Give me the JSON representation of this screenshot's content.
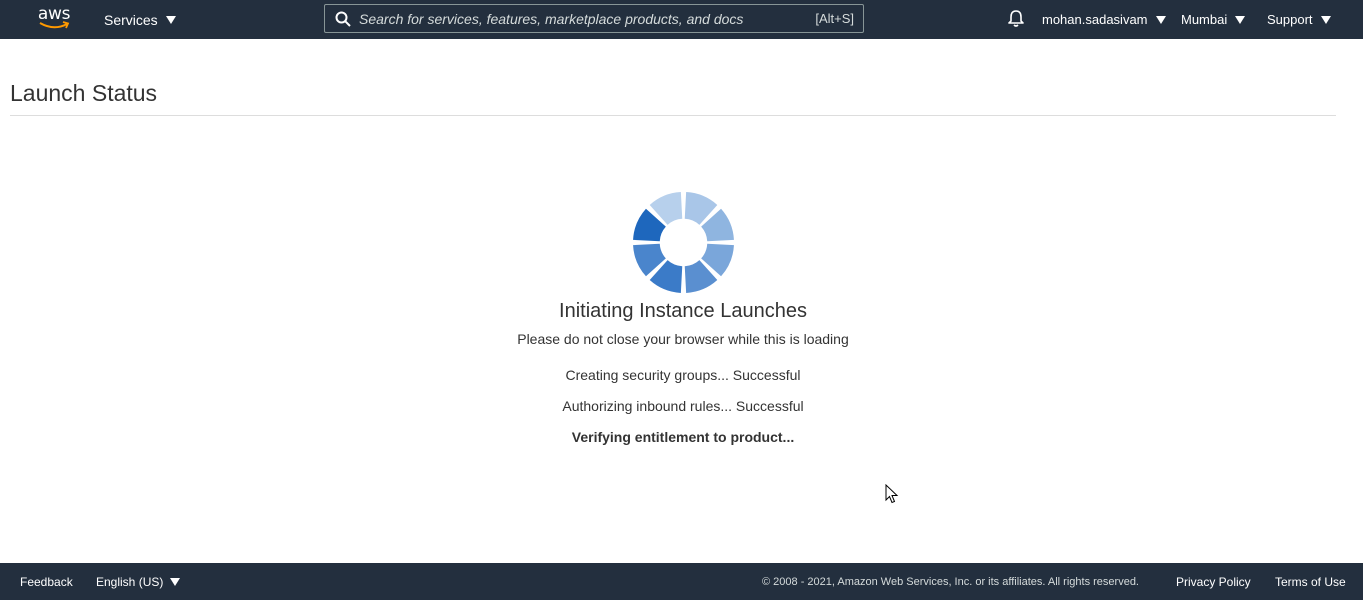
{
  "nav": {
    "logo_text": "aws",
    "services_label": "Services",
    "search": {
      "placeholder": "Search for services, features, marketplace products, and docs",
      "shortcut": "[Alt+S]"
    },
    "user_label": "mohan.sadasivam",
    "region_label": "Mumbai",
    "support_label": "Support"
  },
  "page": {
    "title": "Launch Status"
  },
  "status": {
    "heading": "Initiating Instance Launches",
    "subtext": "Please do not close your browser while this is loading",
    "steps": [
      {
        "text": "Creating security groups... Successful",
        "state": "done"
      },
      {
        "text": "Authorizing inbound rules... Successful",
        "state": "done"
      },
      {
        "text": "Verifying entitlement to product...",
        "state": "in-progress"
      }
    ]
  },
  "footer": {
    "feedback_label": "Feedback",
    "language_label": "English (US)",
    "copyright": "© 2008 - 2021, Amazon Web Services, Inc. or its affiliates. All rights reserved.",
    "privacy_label": "Privacy Policy",
    "terms_label": "Terms of Use"
  },
  "colors": {
    "nav_bg": "#232f3e",
    "aws_orange": "#ff9900",
    "spinner_blue": "#1565c0"
  }
}
